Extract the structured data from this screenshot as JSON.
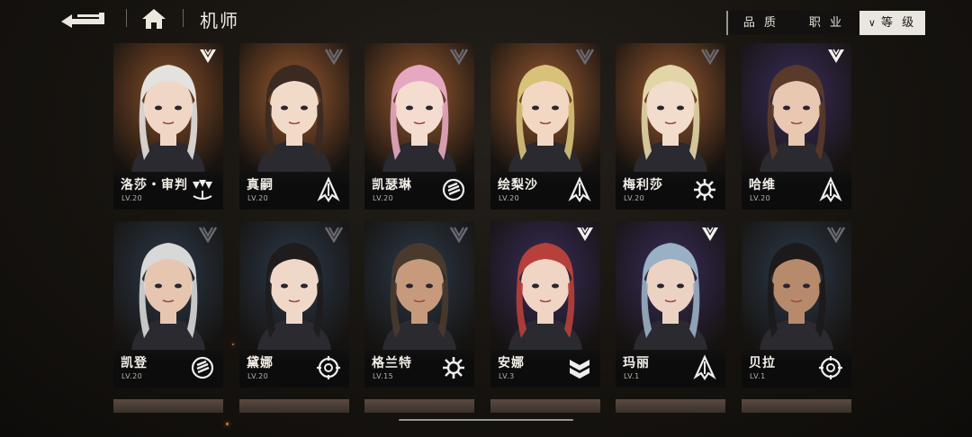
{
  "header": {
    "title": "机师",
    "back_icon": "back-arrow-icon",
    "home_icon": "home-icon"
  },
  "sort": {
    "options": [
      {
        "label": "品 质",
        "active": false
      },
      {
        "label": "职 业",
        "active": false
      },
      {
        "label": "等 级",
        "active": true,
        "icon": "chevron-down-icon"
      }
    ]
  },
  "colors": {
    "accent_bronze": "#9c5a2e",
    "accent_purple": "#3a2d5c",
    "accent_steel": "#2c3a4a",
    "info_bar": "#0c0c0c"
  },
  "pilots": [
    {
      "name": "洛莎・审判",
      "level": "LV.20",
      "rank_icon": "rank-s-icon",
      "class_icon": "support-drones-icon",
      "bg": "#8a4f2a",
      "hair": "#e4e2df",
      "skin": "#f0d6c4"
    },
    {
      "name": "真嗣",
      "level": "LV.20",
      "rank_icon": "rank-a-icon",
      "class_icon": "assault-spear-icon",
      "bg": "#9a5a30",
      "hair": "#3a2a22",
      "skin": "#f2dac8"
    },
    {
      "name": "凯瑟琳",
      "level": "LV.20",
      "rank_icon": "rank-a-icon",
      "class_icon": "striker-fist-icon",
      "bg": "#9a5a30",
      "hair": "#e6a8c0",
      "skin": "#f4dcd0"
    },
    {
      "name": "绘梨沙",
      "level": "LV.20",
      "rank_icon": "rank-a-icon",
      "class_icon": "assault-spear-icon",
      "bg": "#9a5a30",
      "hair": "#d8c27a",
      "skin": "#f2d8c2"
    },
    {
      "name": "梅利莎",
      "level": "LV.20",
      "rank_icon": "rank-a-icon",
      "class_icon": "engineer-gear-icon",
      "bg": "#9a5a30",
      "hair": "#e2d6a8",
      "skin": "#f2dccb"
    },
    {
      "name": "哈维",
      "level": "LV.20",
      "rank_icon": "rank-s-icon",
      "class_icon": "assault-spear-icon",
      "bg": "#3a2d5c",
      "hair": "#5a3a2a",
      "skin": "#e8c8b0"
    },
    {
      "name": "凯登",
      "level": "LV.20",
      "rank_icon": "rank-a-icon",
      "class_icon": "striker-fist-icon",
      "bg": "#2c3a4a",
      "hair": "#d8d8d8",
      "skin": "#e6c6b0"
    },
    {
      "name": "黛娜",
      "level": "LV.20",
      "rank_icon": "rank-a-icon",
      "class_icon": "sniper-target-icon",
      "bg": "#2c3a4a",
      "hair": "#1e1c1c",
      "skin": "#f0d8c8"
    },
    {
      "name": "格兰特",
      "level": "LV.15",
      "rank_icon": "rank-a-icon",
      "class_icon": "engineer-gear-icon",
      "bg": "#2c3a4a",
      "hair": "#4a3a2e",
      "skin": "#c89a7c"
    },
    {
      "name": "安娜",
      "level": "LV.3",
      "rank_icon": "rank-s-icon",
      "class_icon": "defender-chevron-icon",
      "bg": "#3a2d5c",
      "hair": "#b8403a",
      "skin": "#f0d4c4"
    },
    {
      "name": "玛丽",
      "level": "LV.1",
      "rank_icon": "rank-s-icon",
      "class_icon": "assault-spear-icon",
      "bg": "#3a2d5c",
      "hair": "#9ab0c4",
      "skin": "#ecd2c2"
    },
    {
      "name": "贝拉",
      "level": "LV.1",
      "rank_icon": "rank-a-icon",
      "class_icon": "sniper-target-icon",
      "bg": "#2c3a4a",
      "hair": "#1c1a1a",
      "skin": "#b88a6c"
    }
  ],
  "partial_row_count": 6
}
